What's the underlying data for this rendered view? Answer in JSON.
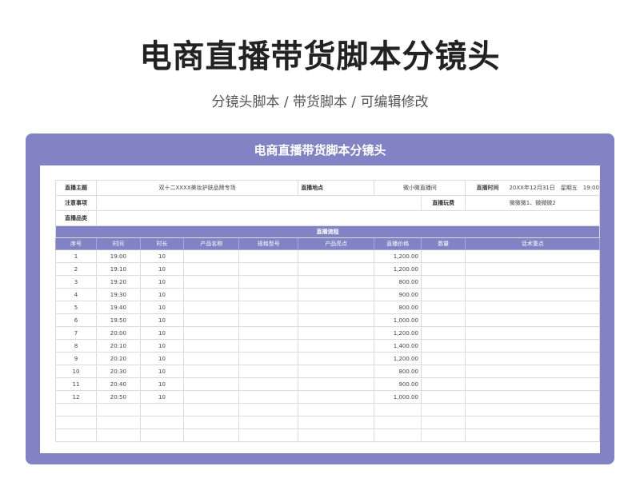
{
  "page": {
    "title": "电商直播带货脚本分镜头",
    "subtitle": "分镜头脚本 / 带货脚本 / 可编辑修改"
  },
  "sheet": {
    "title": "电商直播带货脚本分镜头",
    "info": {
      "theme_label": "直播主题",
      "theme_value": "双十二XXXX美妆护肤品牌专场",
      "location_label": "直播地点",
      "location_value": "微小微直播间",
      "time_label": "直播时间",
      "time_value": "20XX年12月31日　星期五　19:00",
      "notes_label": "注意事项",
      "notes_value": "",
      "host_label": "直播玩费",
      "host_value": "微微微1、微微微2",
      "category_label": "直播品类",
      "category_value": ""
    },
    "section_title": "直播流程",
    "columns": [
      "序号",
      "时间",
      "时长",
      "产品名称",
      "规格型号",
      "产品亮点",
      "直播价格",
      "数量",
      "话术重点"
    ],
    "rows": [
      {
        "no": "1",
        "time": "19:00",
        "duration": "10",
        "price": "1,200.00"
      },
      {
        "no": "2",
        "time": "19:10",
        "duration": "10",
        "price": "1,200.00"
      },
      {
        "no": "3",
        "time": "19:20",
        "duration": "10",
        "price": "800.00"
      },
      {
        "no": "4",
        "time": "19:30",
        "duration": "10",
        "price": "900.00"
      },
      {
        "no": "5",
        "time": "19:40",
        "duration": "10",
        "price": "800.00"
      },
      {
        "no": "6",
        "time": "19:50",
        "duration": "10",
        "price": "1,000.00"
      },
      {
        "no": "7",
        "time": "20:00",
        "duration": "10",
        "price": "1,200.00"
      },
      {
        "no": "8",
        "time": "20:10",
        "duration": "10",
        "price": "1,400.00"
      },
      {
        "no": "9",
        "time": "20:20",
        "duration": "10",
        "price": "1,200.00"
      },
      {
        "no": "10",
        "time": "20:30",
        "duration": "10",
        "price": "800.00"
      },
      {
        "no": "11",
        "time": "20:40",
        "duration": "10",
        "price": "900.00"
      },
      {
        "no": "12",
        "time": "20:50",
        "duration": "10",
        "price": "1,000.00"
      }
    ],
    "empty_rows": 3
  },
  "colors": {
    "accent": "#8183c4",
    "grid": "#dcdcdc"
  }
}
